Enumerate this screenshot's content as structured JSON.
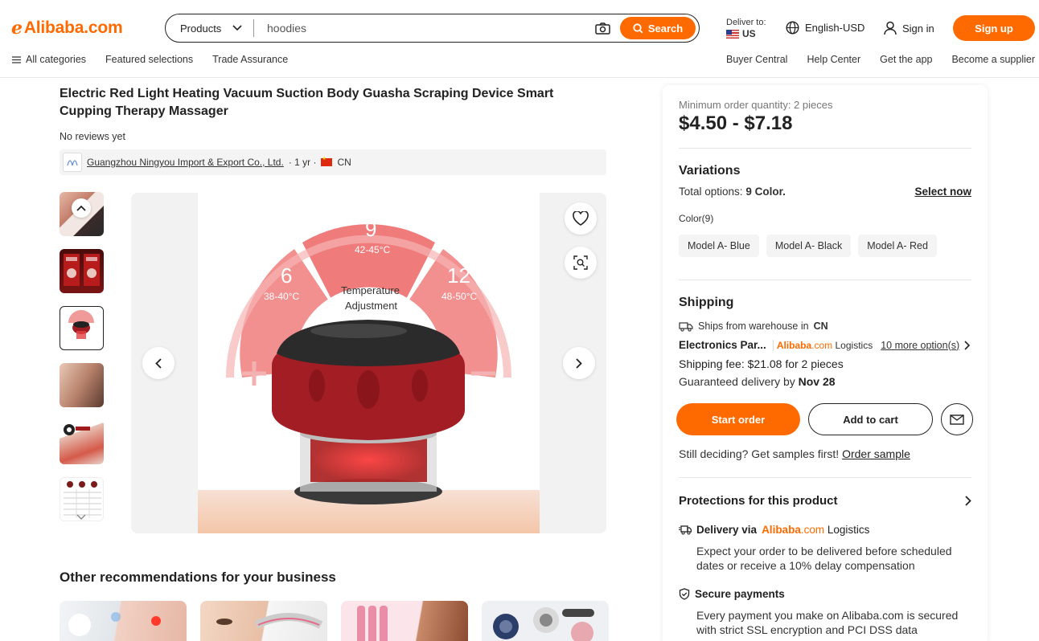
{
  "header": {
    "logo_text": "Alibaba.com",
    "search": {
      "category": "Products",
      "query": "hoodies",
      "button_label": "Search"
    },
    "deliver_to_label": "Deliver to:",
    "deliver_to_country": "US",
    "language": "English-USD",
    "sign_in": "Sign in",
    "sign_up": "Sign up",
    "subnav_left": [
      "All categories",
      "Featured selections",
      "Trade Assurance"
    ],
    "subnav_right": [
      "Buyer Central",
      "Help Center",
      "Get the app",
      "Become a supplier"
    ]
  },
  "product": {
    "title": "Electric Red Light Heating Vacuum Suction Body Guasha Scraping Device Smart Cupping Therapy Massager",
    "reviews": "No reviews yet",
    "supplier_name": "Guangzhou Ningyou Import & Export Co., Ltd.",
    "supplier_years": "· 1 yr ·",
    "supplier_country": "CN",
    "main_image_text": {
      "left_level": "6",
      "left_temp": "38-40°C",
      "mid_level": "9",
      "mid_temp": "42-45°C",
      "right_level": "12",
      "right_temp": "48-50°C",
      "center_line1": "Temperature",
      "center_line2": "Adjustment"
    }
  },
  "recommendations": {
    "title": "Other recommendations for your business"
  },
  "panel": {
    "moq": "Minimum order quantity: 2 pieces",
    "price": "$4.50 - $7.18",
    "variations_title": "Variations",
    "total_prefix": "Total options: ",
    "total_value": "9 Color.",
    "select_now": "Select now",
    "color_label": "Color(9)",
    "colors": [
      "Model A- Blue",
      "Model A- Black",
      "Model A- Red"
    ],
    "shipping_title": "Shipping",
    "ships_from_prefix": "Ships from warehouse in ",
    "ships_from_country": "CN",
    "logistics_name": "Electronics Par...",
    "logistics_brand_1": "Alibaba",
    "logistics_brand_2": ".com",
    "logistics_brand_3": " Logistics",
    "more_options": "10 more option(s)",
    "shipping_fee": "Shipping fee: $21.08 for 2 pieces",
    "guaranteed_prefix": "Guaranteed delivery by ",
    "guaranteed_date": "Nov 28",
    "start_order": "Start order",
    "add_to_cart": "Add to cart",
    "samples_prefix": "Still deciding? Get samples first! ",
    "order_sample": "Order sample",
    "protections_title": "Protections for this product",
    "delivery_prefix": "Delivery via ",
    "delivery_desc": "Expect your order to be delivered before scheduled dates or receive a 10% delay compensation",
    "secure_title": "Secure payments",
    "secure_desc": "Every payment you make on Alibaba.com is secured with strict SSL encryption and PCI DSS data"
  },
  "colors": {
    "brand": "#ff6a00",
    "text": "#222222"
  }
}
